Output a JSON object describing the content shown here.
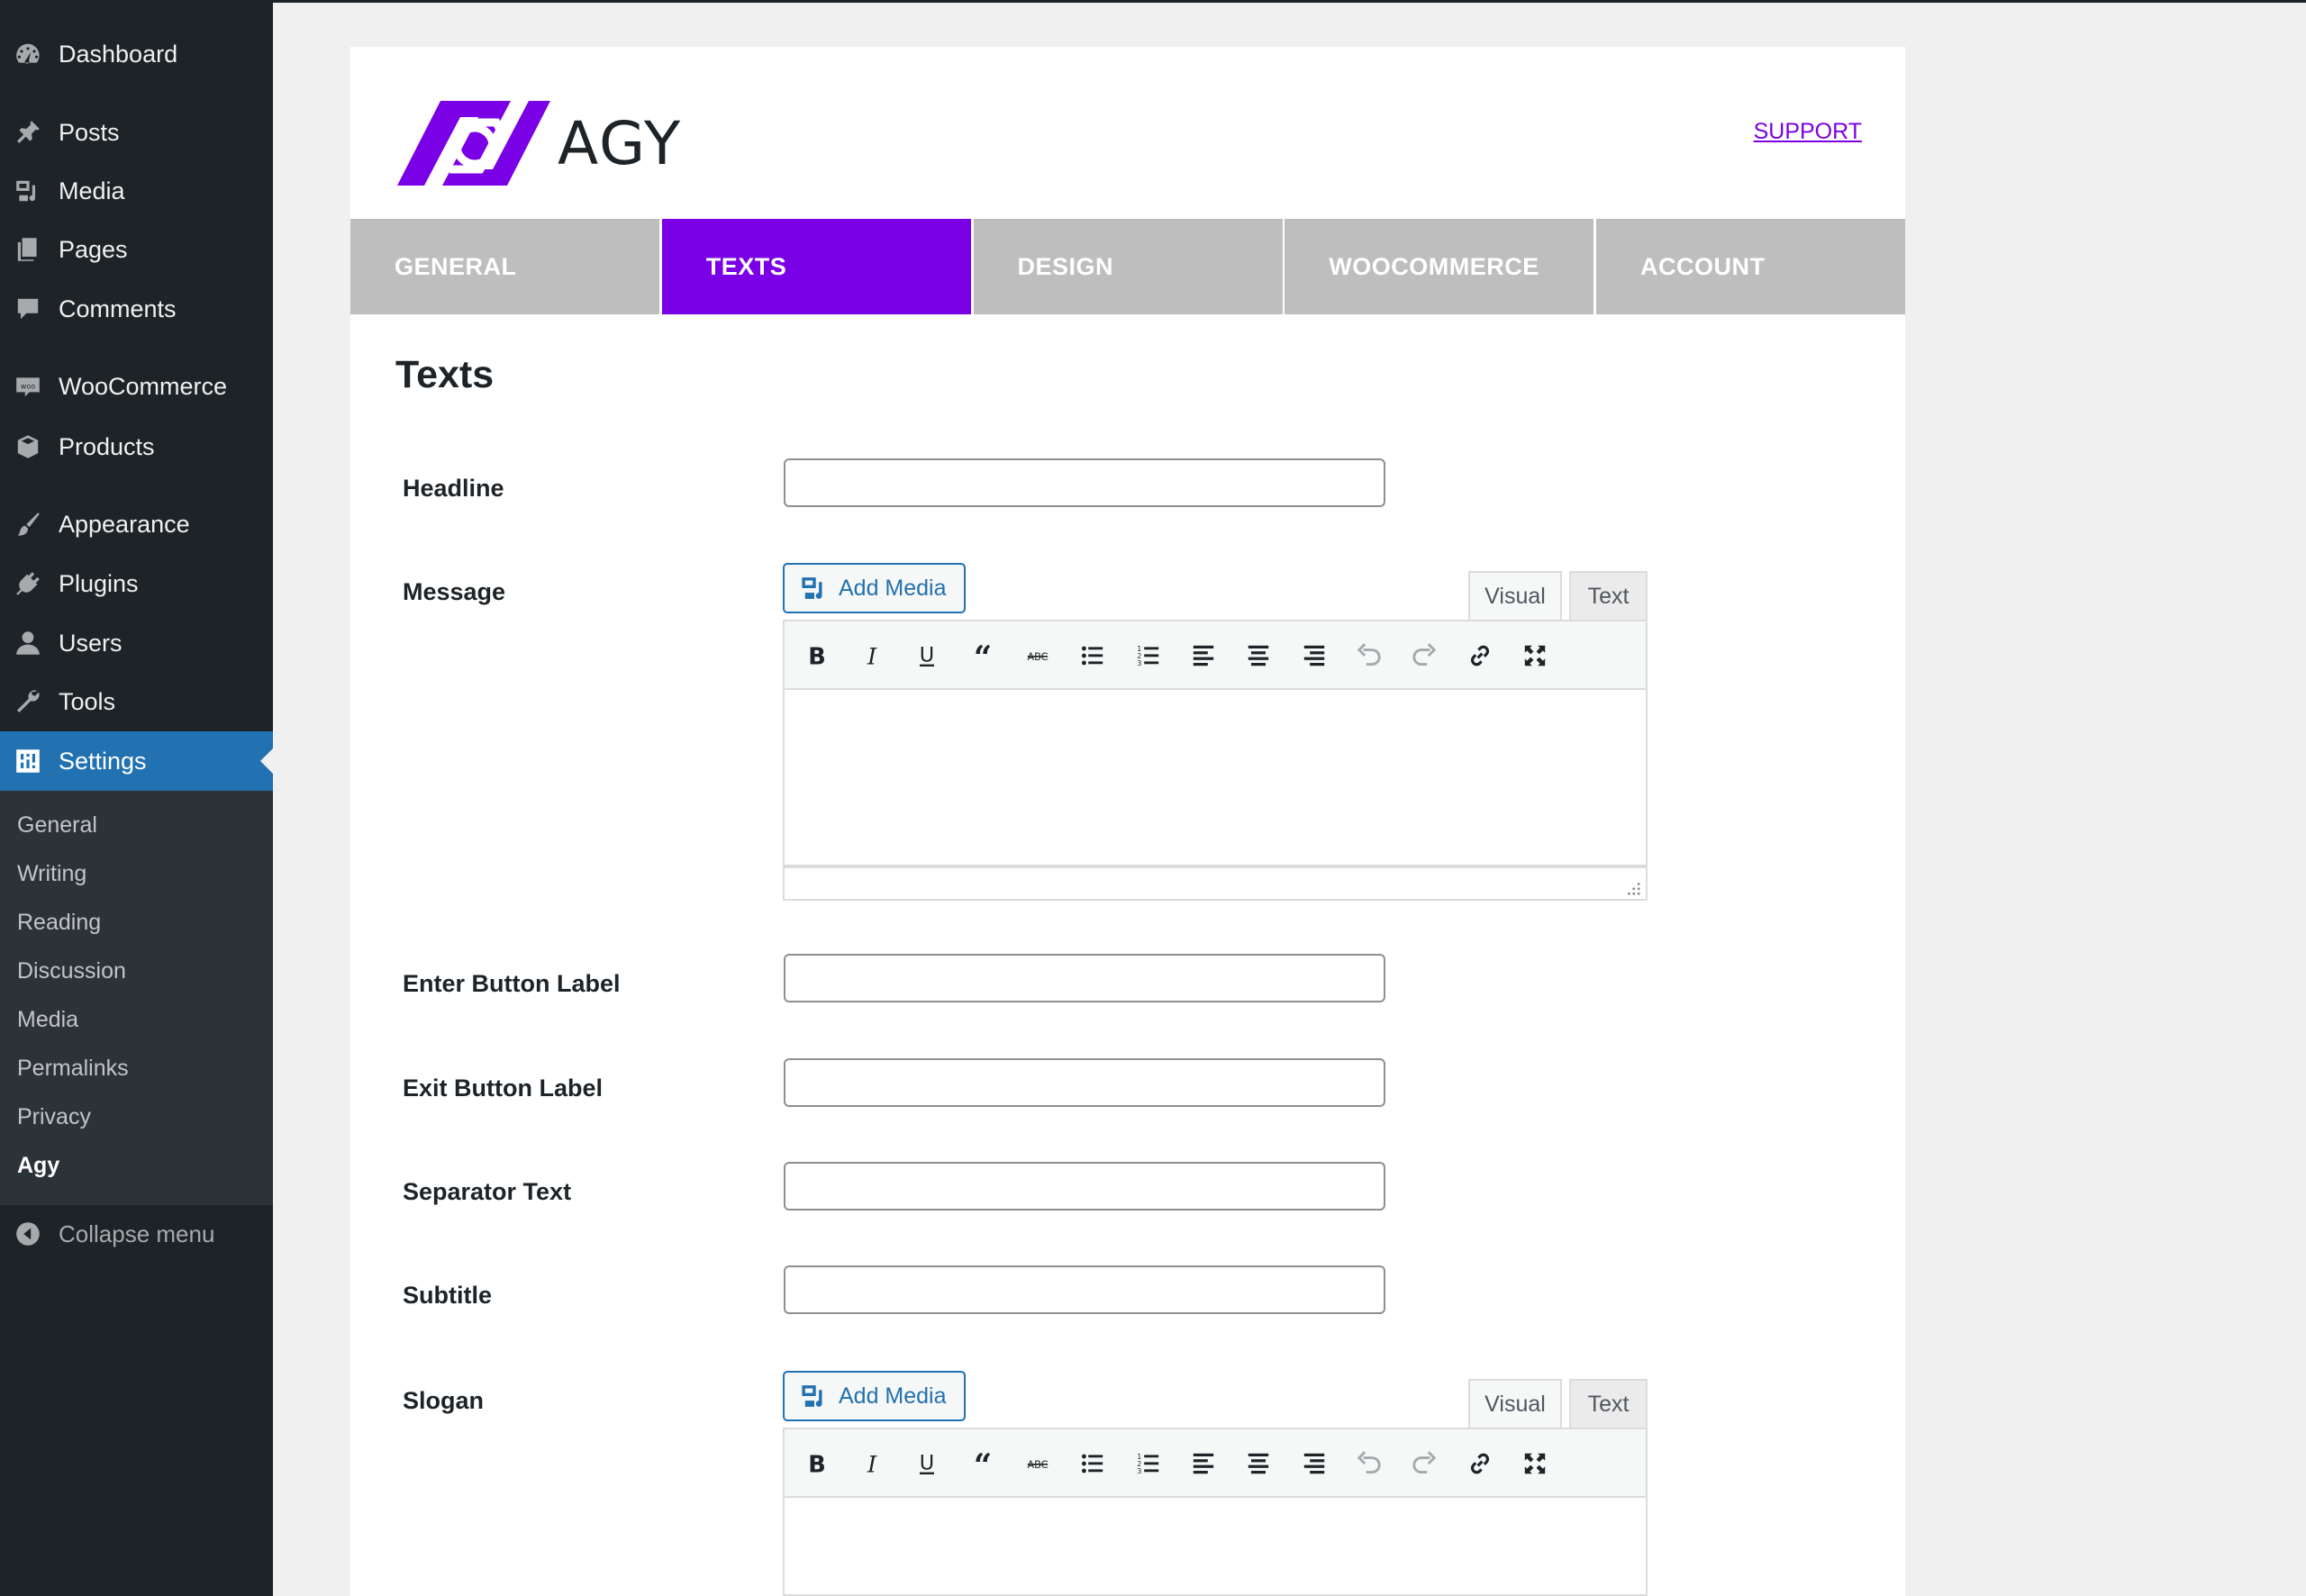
{
  "sidebar": {
    "items": [
      {
        "label": "Dashboard",
        "icon": "dashboard-icon"
      },
      {
        "label": "Posts",
        "icon": "pin-icon"
      },
      {
        "label": "Media",
        "icon": "media-icon"
      },
      {
        "label": "Pages",
        "icon": "pages-icon"
      },
      {
        "label": "Comments",
        "icon": "comments-icon"
      },
      {
        "label": "WooCommerce",
        "icon": "woo-icon"
      },
      {
        "label": "Products",
        "icon": "box-icon"
      },
      {
        "label": "Appearance",
        "icon": "brush-icon"
      },
      {
        "label": "Plugins",
        "icon": "plug-icon"
      },
      {
        "label": "Users",
        "icon": "user-icon"
      },
      {
        "label": "Tools",
        "icon": "wrench-icon"
      },
      {
        "label": "Settings",
        "icon": "settings-icon",
        "active": true
      }
    ],
    "submenu": [
      "General",
      "Writing",
      "Reading",
      "Discussion",
      "Media",
      "Permalinks",
      "Privacy",
      "Agy"
    ],
    "submenu_current": "Agy",
    "collapse_label": "Collapse menu"
  },
  "header": {
    "logo_text": "AGY",
    "support_link": "SUPPORT"
  },
  "tabs": [
    {
      "label": "GENERAL",
      "active": false
    },
    {
      "label": "TEXTS",
      "active": true
    },
    {
      "label": "DESIGN",
      "active": false
    },
    {
      "label": "WOOCOMMERCE",
      "active": false
    },
    {
      "label": "ACCOUNT",
      "active": false
    }
  ],
  "section_title": "Texts",
  "fields": {
    "headline": {
      "label": "Headline",
      "value": ""
    },
    "message": {
      "label": "Message"
    },
    "enter_button": {
      "label": "Enter Button Label",
      "value": ""
    },
    "exit_button": {
      "label": "Exit Button Label",
      "value": ""
    },
    "separator": {
      "label": "Separator Text",
      "value": ""
    },
    "subtitle": {
      "label": "Subtitle",
      "value": ""
    },
    "slogan": {
      "label": "Slogan"
    }
  },
  "editor": {
    "add_media_label": "Add Media",
    "visual_tab": "Visual",
    "text_tab": "Text",
    "toolbar": [
      "bold",
      "italic",
      "underline",
      "blockquote",
      "strikethrough",
      "bullet-list",
      "numbered-list",
      "align-left",
      "align-center",
      "align-right",
      "undo",
      "redo",
      "link",
      "fullscreen"
    ]
  },
  "colors": {
    "accent": "#7a00e6",
    "tab_inactive": "#bebebe",
    "wp_blue": "#2271b1",
    "sidebar_bg": "#1d2327",
    "submenu_bg": "#2c3338"
  }
}
